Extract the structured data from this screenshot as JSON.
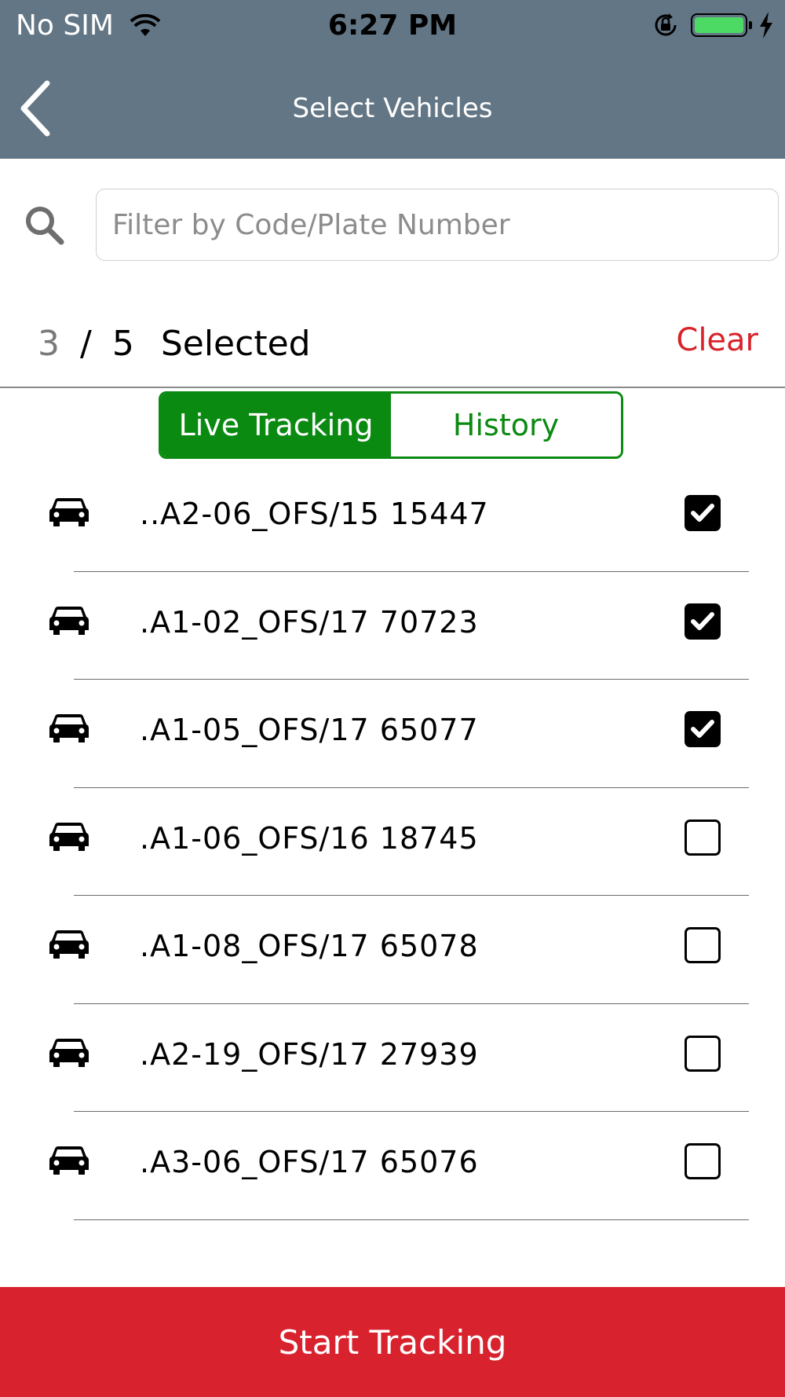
{
  "status_bar": {
    "carrier": "No SIM",
    "time": "6:27 PM",
    "battery_color": "#4cd964"
  },
  "nav": {
    "title": "Select Vehicles",
    "back_icon": "chevron-left-icon"
  },
  "search": {
    "placeholder": "Filter by Code/Plate Number",
    "value": ""
  },
  "selection": {
    "selected": "3",
    "separator": "/",
    "total": "5",
    "label": "Selected",
    "clear_label": "Clear"
  },
  "tabs": [
    {
      "label": "Live Tracking",
      "active": true
    },
    {
      "label": "History",
      "active": false
    }
  ],
  "vehicles": [
    {
      "label": "..A2-06_OFS/15 15447",
      "checked": true
    },
    {
      "label": ".A1-02_OFS/17 70723",
      "checked": true
    },
    {
      "label": ".A1-05_OFS/17 65077",
      "checked": true
    },
    {
      "label": ".A1-06_OFS/16 18745",
      "checked": false
    },
    {
      "label": ".A1-08_OFS/17 65078",
      "checked": false
    },
    {
      "label": ".A2-19_OFS/17 27939",
      "checked": false
    },
    {
      "label": ".A3-06_OFS/17 65076",
      "checked": false
    }
  ],
  "start_button": {
    "label": "Start Tracking"
  },
  "colors": {
    "header": "#637685",
    "accent_green": "#0b8a12",
    "accent_red": "#d8232f"
  }
}
